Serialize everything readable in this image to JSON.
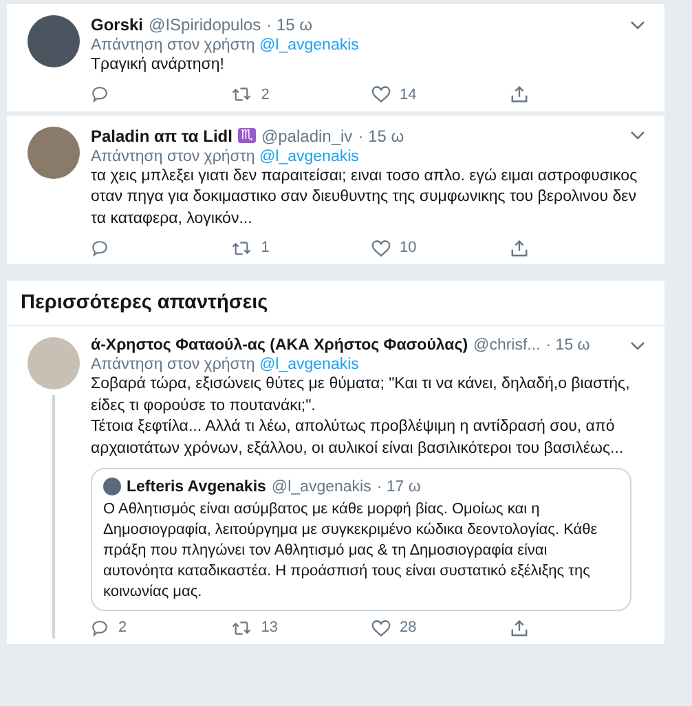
{
  "replies_top": [
    {
      "name": "Gorski",
      "handle": "@ISpiridopulos",
      "time": "· 15 ω",
      "reply_label": "Απάντηση στον χρήστη",
      "reply_handle": "@l_avgenakis",
      "text": "Τραγική ανάρτηση!",
      "retweets": "2",
      "likes": "14"
    },
    {
      "name": "Paladin απ τα Lidl",
      "name_emoji": "♏",
      "handle": "@paladin_iv",
      "time": "· 15 ω",
      "reply_label": "Απάντηση στον χρήστη",
      "reply_handle": "@l_avgenakis",
      "text": "τα χεις μπλεξει γιατι δεν παραιτείσαι; ειναι τοσο απλο. εγώ ειμαι αστροφυσικος οταν πηγα για δοκιμαστικο σαν διευθυντης της συμφωνικης του βερολινου δεν τα καταφερα, λογικόν...",
      "retweets": "1",
      "likes": "10"
    }
  ],
  "more_replies": {
    "heading": "Περισσότερες απαντήσεις",
    "tweets": [
      {
        "name": "ά-Χρηστος Φαταούλ-ας (ΑΚΑ Χρήστος Φασούλας)",
        "handle": "@chrisf...",
        "time": "· 15 ω",
        "reply_label": "Απάντηση στον χρήστη",
        "reply_handle": "@l_avgenakis",
        "text": "Σοβαρά τώρα, εξισώνεις θύτες με θύματα; \"Και τι να κάνει, δηλαδή,ο βιαστής, είδες τι φορούσε το πουτανάκι;\".\nΤέτοια ξεφτίλα... Αλλά τι λέω, απολύτως προβλέψιμη η αντίδρασή σου, από αρχαιοτάτων χρόνων, εξάλλου, οι αυλικοί είναι βασιλικότεροι του βασιλέως...",
        "thread_line": true,
        "quote": {
          "name": "Lefteris Avgenakis",
          "handle": "@l_avgenakis",
          "time": "· 17 ω",
          "text": "Ο Αθλητισμός είναι ασύμβατος με κάθε μορφή βίας. Ομοίως και η Δημοσιογραφία, λειτούργημα με συγκεκριμένο κώδικα δεοντολογίας. Κάθε πράξη που πληγώνει τον Αθλητισμό μας & τη Δημοσιογραφία είναι αυτονόητα καταδικαστέα. Η προάσπισή τους είναι συστατικό εξέλιξης της κοινωνίας μας."
        },
        "replies": "2",
        "retweets": "13",
        "likes": "28"
      }
    ]
  }
}
